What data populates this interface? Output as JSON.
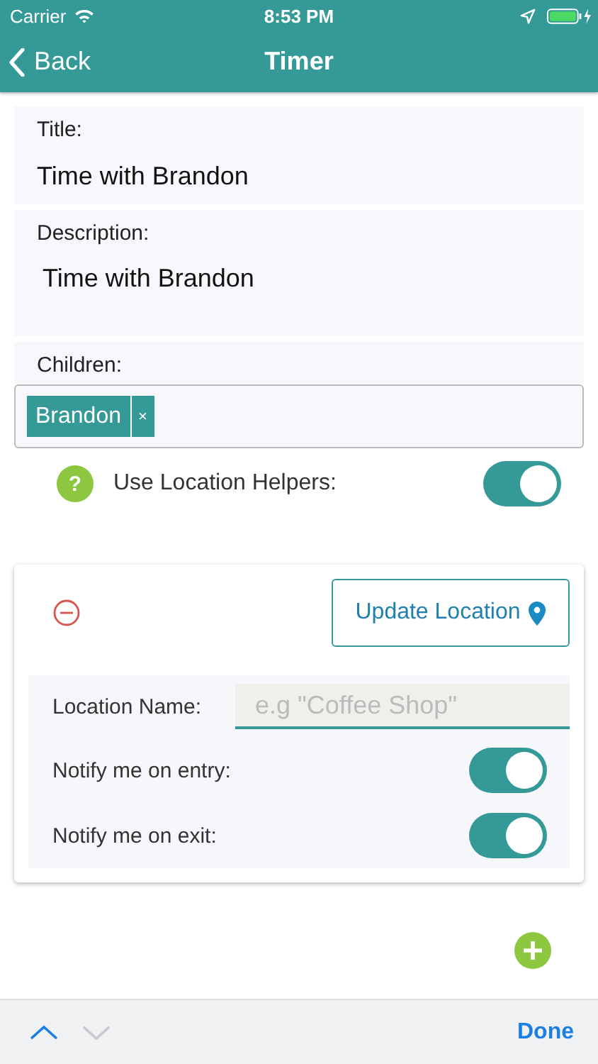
{
  "status_bar": {
    "carrier": "Carrier",
    "time": "8:53 PM"
  },
  "nav": {
    "back": "Back",
    "title": "Timer"
  },
  "title_field": {
    "label": "Title:",
    "value": "Time with Brandon"
  },
  "description_field": {
    "label": "Description:",
    "value": "Time with Brandon"
  },
  "children_field": {
    "label": "Children:",
    "tags": [
      {
        "label": "Brandon",
        "remove": "×"
      }
    ]
  },
  "location_helpers": {
    "label": "Use Location Helpers:",
    "help": "?",
    "on": true
  },
  "location_card": {
    "update_button": "Update Location",
    "name_label": "Location Name:",
    "name_placeholder": "e.g \"Coffee Shop\"",
    "toggles": [
      {
        "label": "Notify me on entry:",
        "on": true
      },
      {
        "label": "Notify me on exit:",
        "on": true
      }
    ]
  },
  "toolbar": {
    "arrows": [
      {
        "kind": "up",
        "disabled": false
      },
      {
        "kind": "down",
        "disabled": true
      }
    ],
    "done": "Done"
  }
}
